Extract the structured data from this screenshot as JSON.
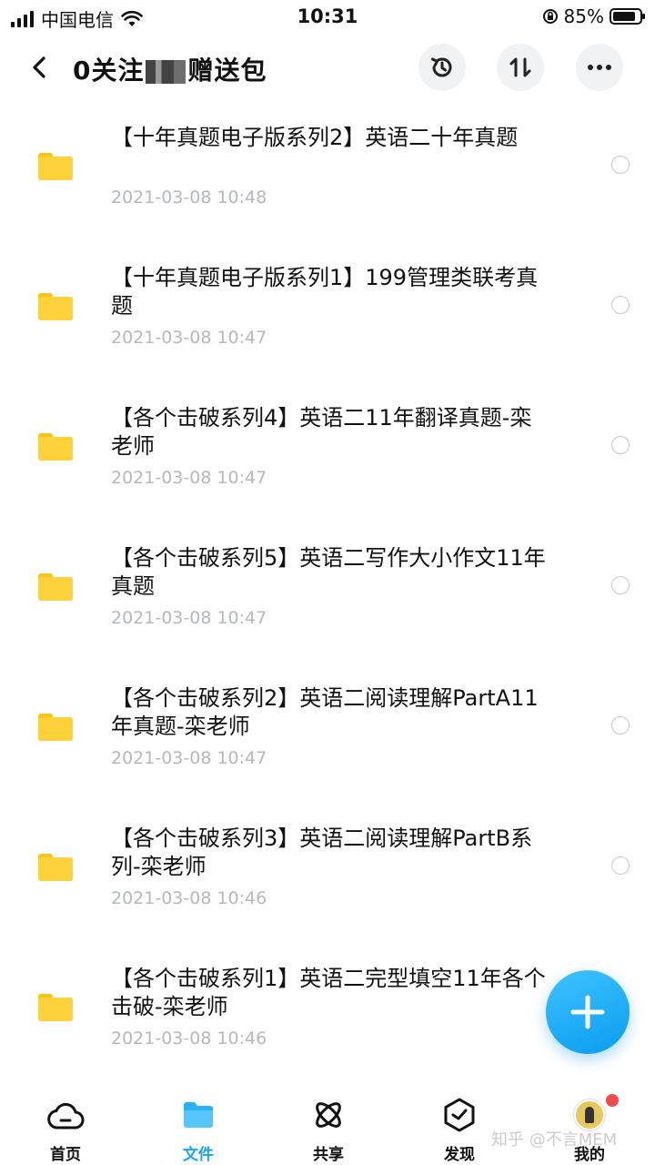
{
  "status_bar": {
    "carrier": "中国电信",
    "time": "10:31",
    "battery": "85%",
    "battery_level": 0.85
  },
  "header": {
    "title_prefix": "0关注",
    "title_suffix": "赠送包",
    "icons": [
      "back-icon",
      "history-icon",
      "sort-icon",
      "more-icon"
    ]
  },
  "files": [
    {
      "name": "【十年真题电子版系列2】英语二十年真题",
      "date": "2021-03-08 10:48"
    },
    {
      "name": "【十年真题电子版系列1】199管理类联考真题",
      "date": "2021-03-08 10:47"
    },
    {
      "name": "【各个击破系列4】英语二11年翻译真题-栾老师",
      "date": "2021-03-08 10:47"
    },
    {
      "name": "【各个击破系列5】英语二写作大小作文11年真题",
      "date": "2021-03-08 10:47"
    },
    {
      "name": "【各个击破系列2】英语二阅读理解PartA11年真题-栾老师",
      "date": "2021-03-08 10:47"
    },
    {
      "name": "【各个击破系列3】英语二阅读理解PartB系列-栾老师",
      "date": "2021-03-08 10:46"
    },
    {
      "name": "【各个击破系列1】英语二完型填空11年各个击破-栾老师",
      "date": "2021-03-08 10:46"
    }
  ],
  "tabs": [
    {
      "label": "首页",
      "icon": "cloud-icon"
    },
    {
      "label": "文件",
      "icon": "folder-icon"
    },
    {
      "label": "共享",
      "icon": "atom-icon"
    },
    {
      "label": "发现",
      "icon": "discover-icon"
    },
    {
      "label": "我的",
      "icon": "avatar-icon"
    }
  ],
  "watermark": "知乎 @不言MEM",
  "colors": {
    "accent": "#1aa3f3",
    "folder": "#ffd23c",
    "date_gray": "#b5b8bd",
    "badge_red": "#f24a4a"
  }
}
